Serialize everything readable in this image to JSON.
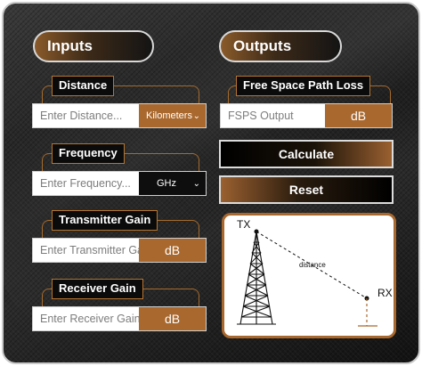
{
  "inputs_header": "Inputs",
  "outputs_header": "Outputs",
  "distance": {
    "label": "Distance",
    "placeholder": "Enter Distance...",
    "unit_selected": "Kilometers",
    "unit_options": [
      "Kilometers"
    ]
  },
  "frequency": {
    "label": "Frequency",
    "placeholder": "Enter Frequency...",
    "unit_selected": "GHz",
    "unit_options": [
      "GHz"
    ]
  },
  "transmitter_gain": {
    "label": "Transmitter Gain",
    "placeholder": "Enter Transmitter Gain...",
    "unit": "dB"
  },
  "receiver_gain": {
    "label": "Receiver Gain",
    "placeholder": "Enter Receiver Gain...",
    "unit": "dB"
  },
  "fspl": {
    "label": "Free Space Path Loss",
    "placeholder": "FSPS Output",
    "unit": "dB"
  },
  "buttons": {
    "calculate": "Calculate",
    "reset": "Reset"
  },
  "diagram": {
    "tx_label": "TX",
    "rx_label": "RX",
    "distance_label": "distance"
  },
  "colors": {
    "accent": "#a9682e",
    "background": "#1c1c1c"
  }
}
